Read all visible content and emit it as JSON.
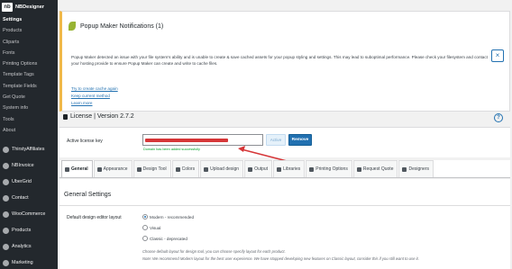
{
  "sidebar": {
    "brand": "NBDesigner",
    "brand_logo": "nb",
    "submenu": [
      {
        "label": "Settings",
        "active": true
      },
      {
        "label": "Products"
      },
      {
        "label": "Cliparts"
      },
      {
        "label": "Fonts"
      },
      {
        "label": "Printing Options"
      },
      {
        "label": "Template Tags"
      },
      {
        "label": "Template Fields"
      },
      {
        "label": "Get Quote"
      },
      {
        "label": "System info"
      },
      {
        "label": "Tools"
      },
      {
        "label": "About"
      }
    ],
    "plugins": [
      {
        "label": "ThirstyAffiliates",
        "icon": "ta-icon"
      },
      {
        "label": "NBInvoice",
        "icon": "invoice-icon"
      },
      {
        "label": "UberGrid",
        "icon": "grid-icon"
      },
      {
        "label": "Contact",
        "icon": "mail-icon"
      },
      {
        "label": "WooCommerce",
        "icon": "woocommerce-icon"
      },
      {
        "label": "Products",
        "icon": "box-icon"
      },
      {
        "label": "Analytics",
        "icon": "chart-icon"
      },
      {
        "label": "Marketing",
        "icon": "megaphone-icon"
      }
    ]
  },
  "notice": {
    "title": "Popup Maker Notifications (1)",
    "body": "Popup Maker detected an issue with your file system's ability and is unable to create & save cached assets for your popup styling and settings. This may lead to suboptimal performance. Please check your filesystem and contact your hosting provide to ensure Popup Maker can create and write to cache files.",
    "links": [
      "Try to create cache again",
      "Keep current method",
      "Learn more"
    ],
    "close_label": "×"
  },
  "license": {
    "title": "License | Version 2.7.2",
    "key_label": "Active license key",
    "status": "Domain has been added successfully",
    "active_label": "Active",
    "remove_label": "Remove",
    "help_label": "?"
  },
  "tabs": [
    {
      "label": "General",
      "icon": "gear-icon",
      "active": true
    },
    {
      "label": "Appearance",
      "icon": "brush-icon"
    },
    {
      "label": "Design Tool",
      "icon": "pencil-icon"
    },
    {
      "label": "Colors",
      "icon": "palette-icon"
    },
    {
      "label": "Upload design",
      "icon": "upload-icon"
    },
    {
      "label": "Output",
      "icon": "filter-icon"
    },
    {
      "label": "Libraries",
      "icon": "link-icon"
    },
    {
      "label": "Printing Options",
      "icon": "grid-icon"
    },
    {
      "label": "Request Quote",
      "icon": "cart-icon"
    },
    {
      "label": "Designers",
      "icon": "user-icon"
    }
  ],
  "general": {
    "section_title": "General Settings",
    "editor_label": "Default design editor layout",
    "options": [
      {
        "label": "Modern - recommended",
        "checked": true
      },
      {
        "label": "Visual"
      },
      {
        "label": "Classic - deprecated"
      }
    ],
    "help1": "Choose default layout for design tool, you can choose specify layout for each product.",
    "help2": "Note: We recommend Modern layout for the best user experience. We have stopped developing new features on Classic layout, consider this if you still want to use it."
  },
  "colors": {
    "sidebar_bg": "#23282d",
    "accent": "#2271b1",
    "notice_border": "#f0b849",
    "success": "#00a32a",
    "arrow": "#d63638"
  }
}
